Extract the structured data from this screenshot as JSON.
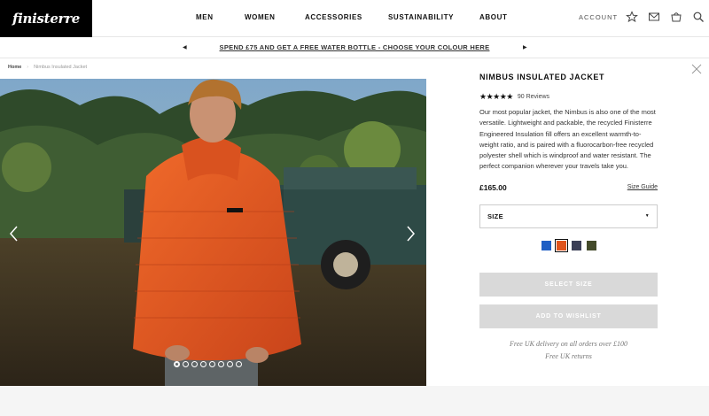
{
  "brand": {
    "logo_text": "finisterre"
  },
  "nav": {
    "items": [
      "MEN",
      "WOMEN",
      "ACCESSORIES",
      "SUSTAINABILITY",
      "ABOUT"
    ],
    "account_label": "ACCOUNT",
    "icons": [
      "star-icon",
      "mail-icon",
      "basket-icon",
      "search-icon"
    ]
  },
  "promo": {
    "text": "SPEND £75 AND GET A FREE WATER BOTTLE - CHOOSE YOUR COLOUR HERE"
  },
  "breadcrumb": {
    "home": "Home",
    "separator": "›",
    "current": "Nimbus Insulated Jacket"
  },
  "gallery": {
    "image_count": 8,
    "active_index": 0
  },
  "product": {
    "title": "NIMBUS INSULATED JACKET",
    "stars": "★★★★★",
    "rating": 5,
    "reviews": "90 Reviews",
    "description": "Our most popular jacket, the Nimbus is also one of the most versatile. Lightweight and packable, the recycled Finisterre Engineered Insulation fill offers an excellent warmth-to-weight ratio, and is paired with a fluorocarbon-free recycled polyester shell which is windproof and water resistant. The perfect companion wherever your travels take you.",
    "price": "£165.00",
    "size_guide": "Size Guide",
    "size_label": "SIZE",
    "colours": [
      "#1f5fc4",
      "#e0541c",
      "#3b3f56",
      "#434a2a"
    ],
    "selected_colour_index": 1,
    "select_size_button": "SELECT SIZE",
    "wishlist_button": "ADD TO WISHLIST",
    "delivery_note": "Free UK delivery on all orders over £100",
    "returns_note": "Free UK returns"
  }
}
